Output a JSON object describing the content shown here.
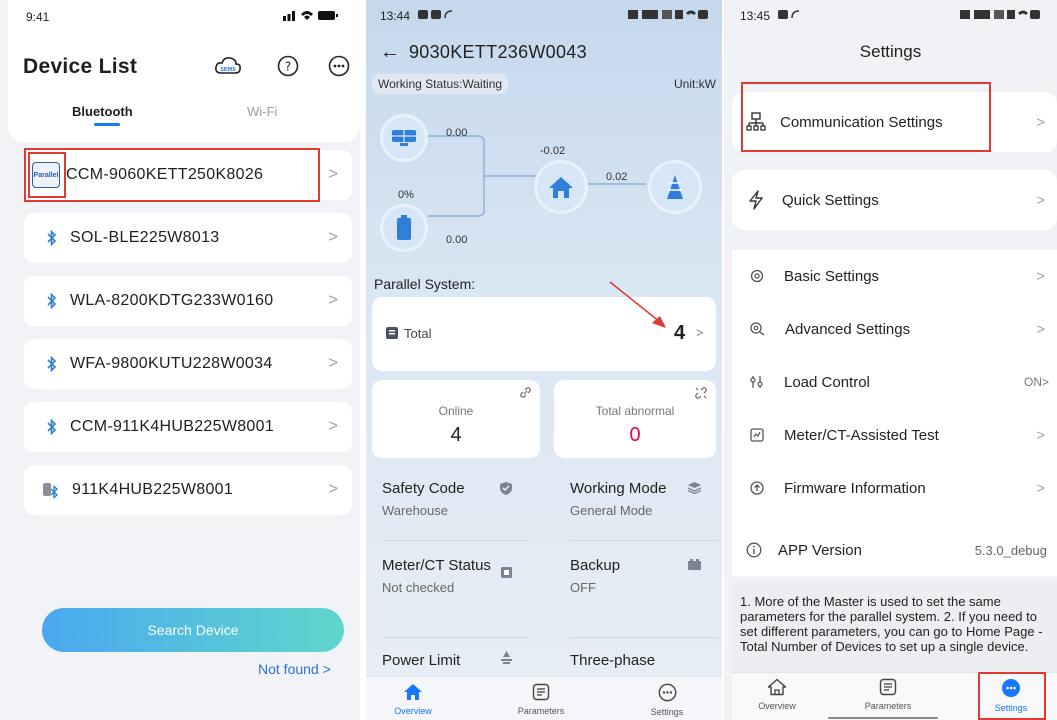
{
  "panel1": {
    "status": {
      "time": "9:41"
    },
    "title": "Device List",
    "tabs": [
      {
        "label": "Bluetooth"
      },
      {
        "label": "Wi-Fi"
      }
    ],
    "devices": [
      {
        "name": "CCM-9060KETT250K8026",
        "badge": "Parallel"
      },
      {
        "name": "SOL-BLE225W8013"
      },
      {
        "name": "WLA-8200KDTG233W0160"
      },
      {
        "name": "WFA-9800KUTU228W0034"
      },
      {
        "name": "CCM-911K4HUB225W8001"
      },
      {
        "name": "911K4HUB225W8001"
      }
    ],
    "cloud_label": "SEMS",
    "search_label": "Search Device",
    "not_found": "Not found >",
    "chevron": ">"
  },
  "panel2": {
    "status": {
      "time": "13:44"
    },
    "title": "9030KETT236W0043",
    "working_status": "Working Status:Waiting",
    "unit": "Unit:kW",
    "flow": {
      "pv": "0.00",
      "grid": "-0.02",
      "load": "0.02",
      "battery_soc": "0%",
      "battery": "0.00"
    },
    "parallel_label": "Parallel System:",
    "total_label": "Total",
    "total_value": "4",
    "online_label": "Online",
    "online_value": "4",
    "abnormal_label": "Total abnormal",
    "abnormal_value": "0",
    "cells": [
      {
        "title": "Safety Code",
        "value": "Warehouse"
      },
      {
        "title": "Working Mode",
        "value": "General Mode"
      },
      {
        "title": "Meter/CT Status",
        "value": "Not checked"
      },
      {
        "title": "Backup",
        "value": "OFF"
      },
      {
        "title": "Power Limit",
        "value": ""
      },
      {
        "title": "Three-phase",
        "value": ""
      }
    ],
    "nav": [
      {
        "label": "Overview"
      },
      {
        "label": "Parameters"
      },
      {
        "label": "Settings"
      }
    ],
    "chevron": ">"
  },
  "panel3": {
    "status": {
      "time": "13:45"
    },
    "title": "Settings",
    "items": [
      {
        "label": "Communication Settings"
      },
      {
        "label": "Quick Settings"
      },
      {
        "label": "Basic Settings"
      },
      {
        "label": "Advanced Settings"
      },
      {
        "label": "Load Control",
        "value": "ON>"
      },
      {
        "label": "Meter/CT-Assisted Test"
      },
      {
        "label": "Firmware Information"
      },
      {
        "label": "APP Version",
        "value": "5.3.0_debug"
      }
    ],
    "note": "1. More of the Master is used to set the same parameters for the parallel system. 2. If you need to set different parameters, you can go to Home Page - Total Number of Devices to set up a single device.",
    "nav": [
      {
        "label": "Overview"
      },
      {
        "label": "Parameters"
      },
      {
        "label": "Settings"
      }
    ],
    "chevron": ">"
  },
  "colors": {
    "accent": "#1677ff",
    "red": "#e23a32",
    "abnormal": "#e8005a",
    "bt": "#2f7fd8"
  }
}
